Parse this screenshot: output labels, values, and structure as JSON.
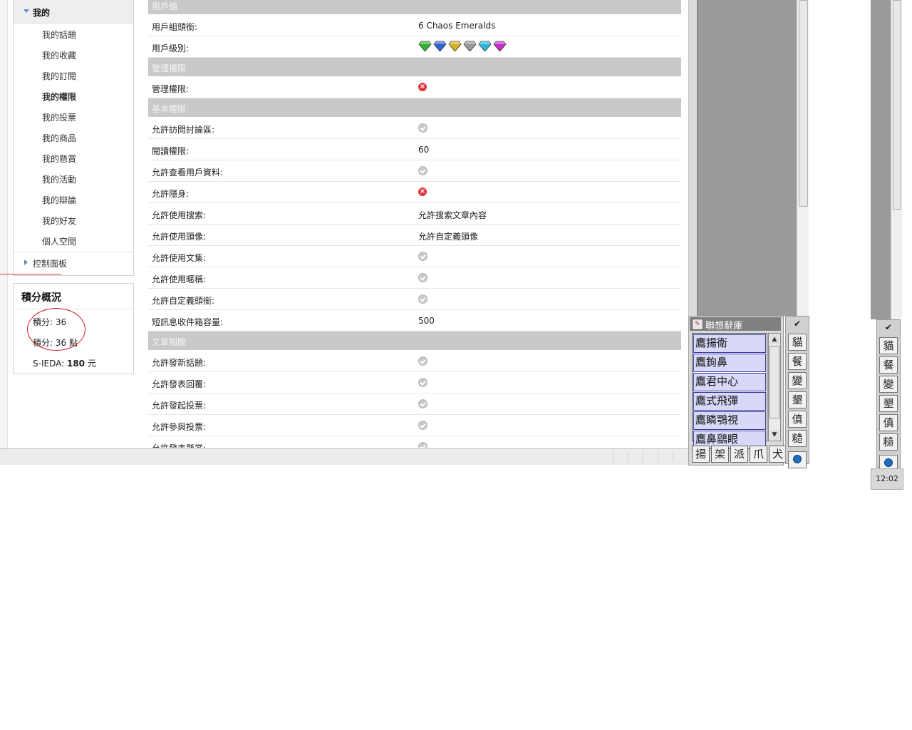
{
  "sidebar": {
    "header": "我的",
    "items": [
      {
        "label": "我的話題"
      },
      {
        "label": "我的收藏"
      },
      {
        "label": "我的訂閱"
      },
      {
        "label": "我的權限"
      },
      {
        "label": "我的投票"
      },
      {
        "label": "我的商品"
      },
      {
        "label": "我的懸賞"
      },
      {
        "label": "我的活動"
      },
      {
        "label": "我的辯論"
      },
      {
        "label": "我的好友"
      },
      {
        "label": "個人空間"
      }
    ],
    "active_item": "我的權限",
    "control_panel": "控制面板"
  },
  "points": {
    "title": "積分概況",
    "line1": "積分: 36",
    "line2": "積分: 36 點",
    "sieda_label": "S-IEDA:",
    "sieda_value": "180",
    "sieda_unit": "元"
  },
  "permissions": {
    "sections": [
      {
        "title": "用戶組",
        "rows": [
          {
            "label": "用戶組頭銜:",
            "type": "text",
            "value": "6 Chaos Emeralds"
          },
          {
            "label": "用戶級別:",
            "type": "gems",
            "gem_colors": [
              "#2fb52f",
              "#2f61d6",
              "#d8b21e",
              "#9a9a9a",
              "#27b7dc",
              "#c52fc6"
            ]
          }
        ]
      },
      {
        "title": "管理權限",
        "rows": [
          {
            "label": "管理權限:",
            "type": "no"
          }
        ]
      },
      {
        "title": "基本權限",
        "rows": [
          {
            "label": "允許訪問討論區:",
            "type": "ok"
          },
          {
            "label": "閱讀權限:",
            "type": "text",
            "value": "60"
          },
          {
            "label": "允許查看用戶資料:",
            "type": "ok"
          },
          {
            "label": "允許隱身:",
            "type": "no"
          },
          {
            "label": "允許使用搜索:",
            "type": "text",
            "value": "允許搜索文章內容"
          },
          {
            "label": "允許使用頭像:",
            "type": "text",
            "value": "允許自定義頭像"
          },
          {
            "label": "允許使用文集:",
            "type": "ok"
          },
          {
            "label": "允許使用暱稱:",
            "type": "ok"
          },
          {
            "label": "允許自定義頭銜:",
            "type": "ok"
          },
          {
            "label": "短訊息收件箱容量:",
            "type": "text",
            "value": "500"
          }
        ]
      },
      {
        "title": "文章相關",
        "rows": [
          {
            "label": "允許發新話題:",
            "type": "ok"
          },
          {
            "label": "允許發表回覆:",
            "type": "ok"
          },
          {
            "label": "允許發起投票:",
            "type": "ok"
          },
          {
            "label": "允許參與投票:",
            "type": "ok"
          },
          {
            "label": "允許發表懸賞:",
            "type": "ok"
          }
        ]
      }
    ]
  },
  "ime": {
    "title": "聯想辭庫",
    "words": [
      "鷹揚衛",
      "鷹鉤鼻",
      "鷹君中心",
      "鷹式飛彈",
      "鷹瞵鶚視",
      "鷹鼻鷂眼"
    ],
    "radicals": [
      "揚",
      "架",
      "派",
      "爪",
      "犬"
    ],
    "toolbar_chars": [
      "貓",
      "餐",
      "變",
      "墾",
      "傎",
      "糙"
    ]
  },
  "clock": {
    "time": "12:02"
  }
}
